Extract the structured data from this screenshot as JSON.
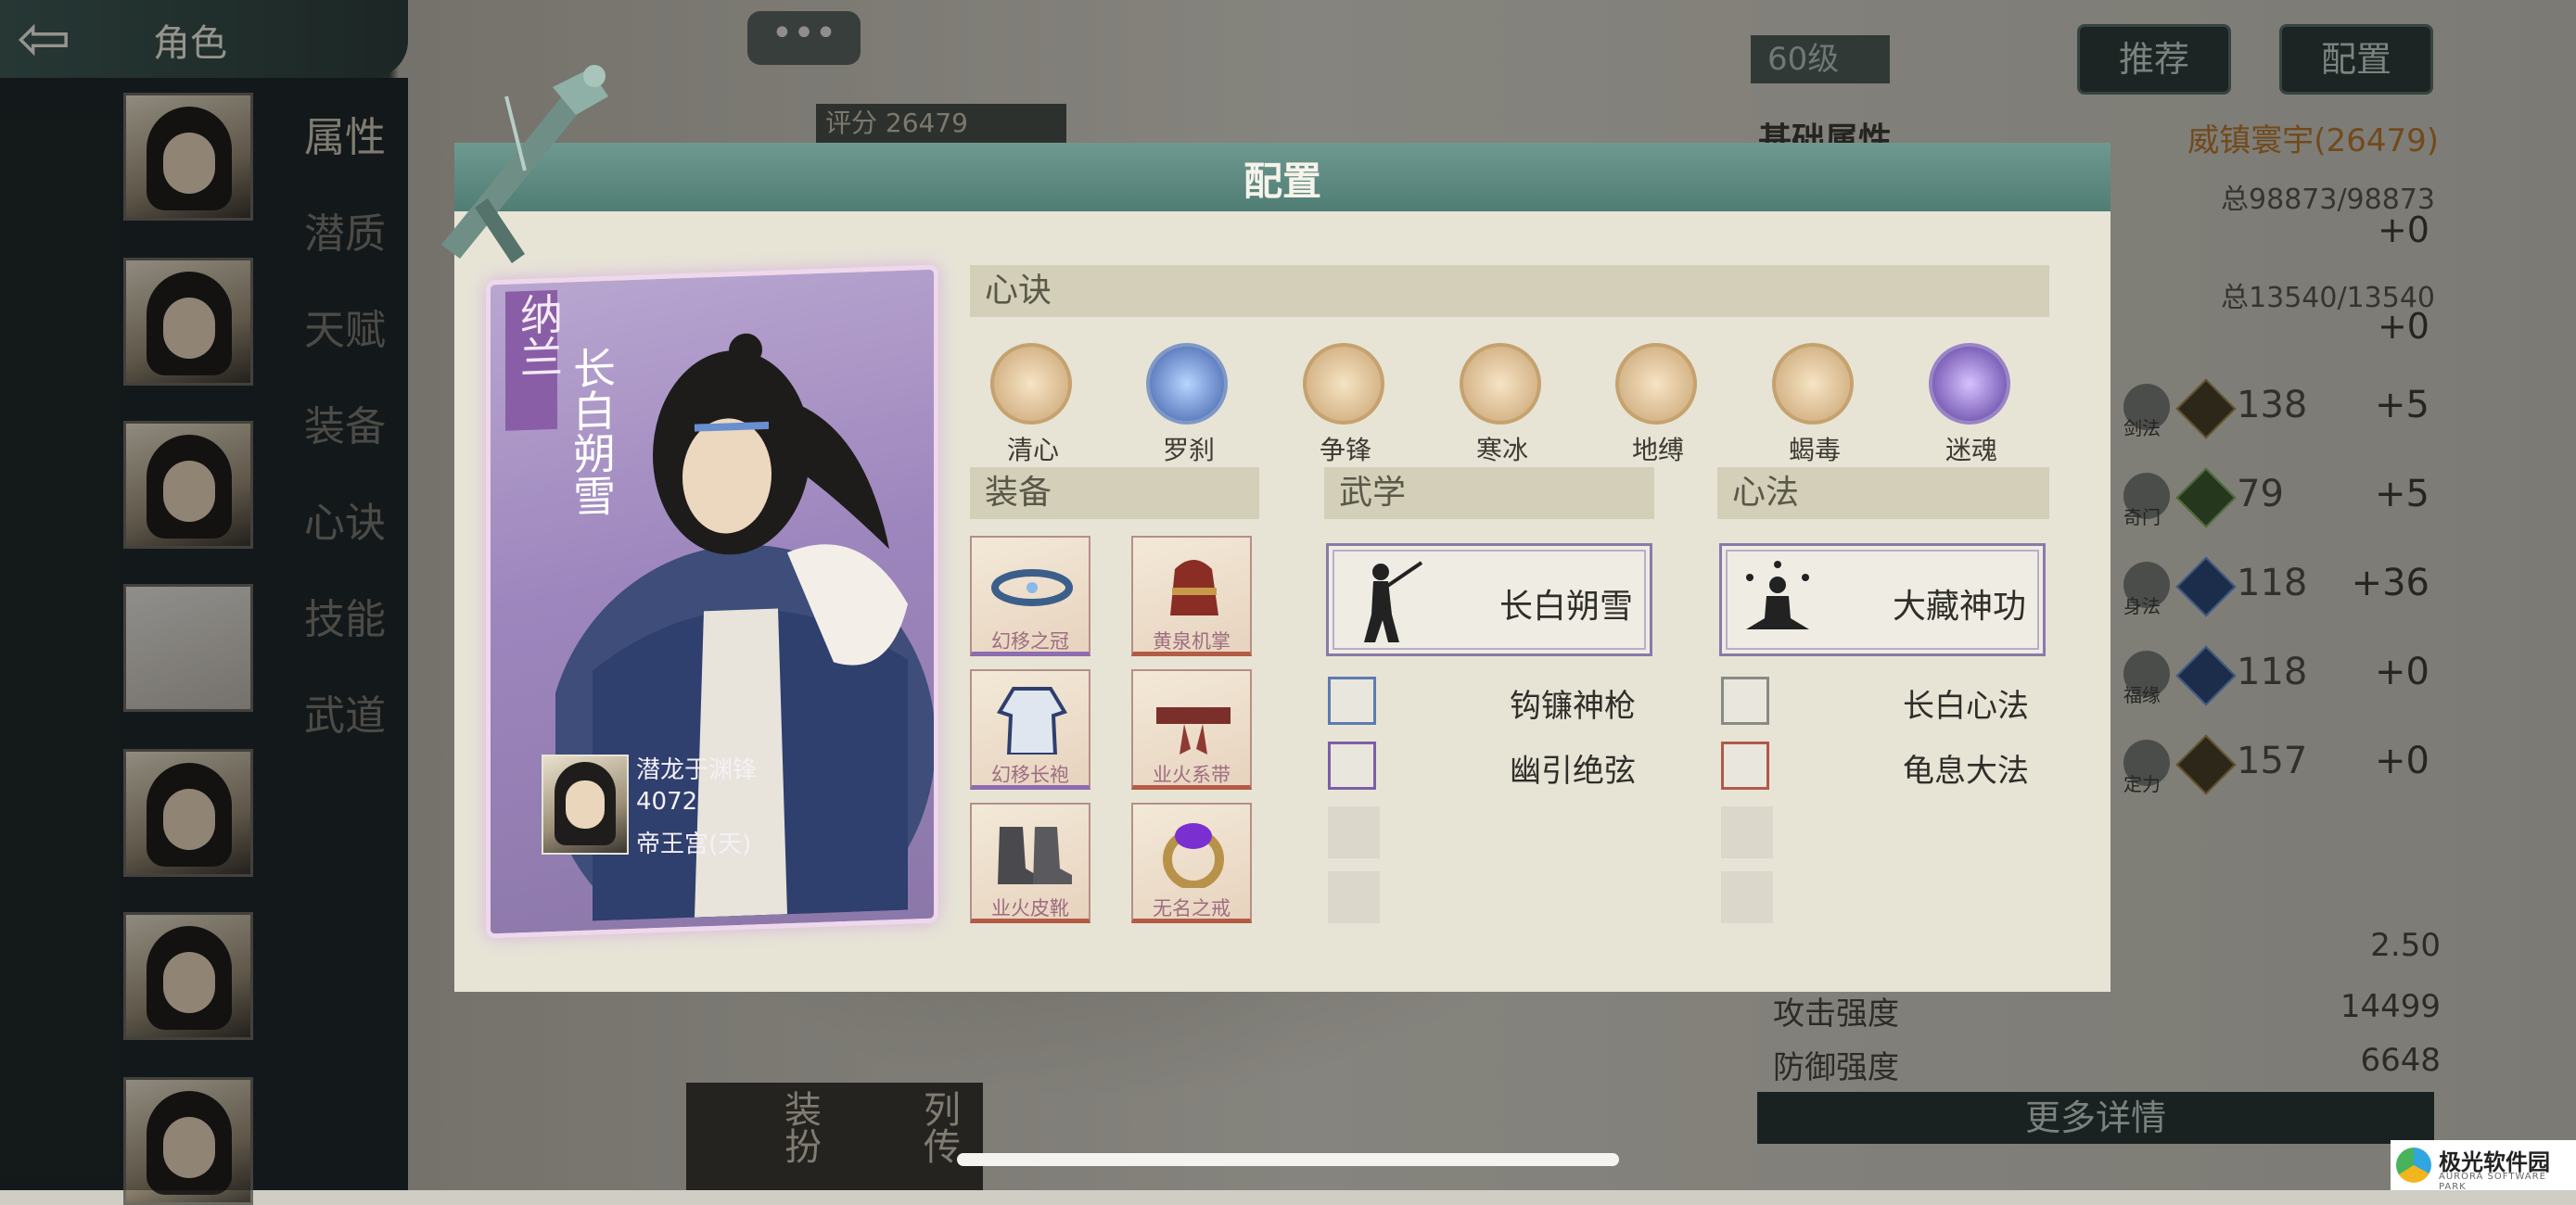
{
  "header": {
    "title": "角色",
    "back_icon": "back-arrow-icon",
    "chat_icon": "chat-bubble-icon",
    "chat_text": "•••"
  },
  "sidebar": {
    "tabs": [
      {
        "label": "属性",
        "active": true
      },
      {
        "label": "潜质",
        "active": false
      },
      {
        "label": "天赋",
        "active": false
      },
      {
        "label": "装备",
        "active": false
      },
      {
        "label": "心诀",
        "active": false
      },
      {
        "label": "技能",
        "active": false
      },
      {
        "label": "武道",
        "active": false
      }
    ]
  },
  "background": {
    "score_label": "评分",
    "score_value": "26479",
    "level": "60级",
    "buttons": {
      "recommend": "推荐",
      "config": "配置"
    },
    "base_attr_title": "基础属性",
    "base_attr_name": "威镇寰宇(26479)",
    "total_hp": "总98873/98873",
    "total_hp_plus": "+0",
    "total_mp": "总13540/13540",
    "total_mp_plus": "+0",
    "stats": [
      {
        "label": "剑法",
        "gem": "田",
        "value": "138",
        "bonus": "+5"
      },
      {
        "label": "奇门",
        "gem": "内",
        "value": "79",
        "bonus": "+5"
      },
      {
        "label": "身法",
        "gem": "",
        "value": "118",
        "bonus": "+36"
      },
      {
        "label": "福缘",
        "gem": "",
        "value": "118",
        "bonus": "+0"
      },
      {
        "label": "定力",
        "gem": "田",
        "value": "157",
        "bonus": "+0"
      }
    ],
    "bottom_stats": [
      {
        "label": "",
        "value": "2.50"
      },
      {
        "label": "攻击强度",
        "value": "14499"
      },
      {
        "label": "防御强度",
        "value": "6648"
      }
    ],
    "more_details": "更多详情",
    "bottom_tabs": [
      "装扮",
      "列传"
    ]
  },
  "modal": {
    "title": "配置",
    "character": {
      "name": "纳兰",
      "title": "长白朔雪",
      "owner_name": "潜龙于渊锋",
      "owner_score": "4072",
      "owner_server": "帝王宫(天)"
    },
    "xinjue": {
      "header": "心诀",
      "items": [
        {
          "label": "清心",
          "icon": "lotus-icon",
          "color": "#d9b98c"
        },
        {
          "label": "罗刹",
          "icon": "lightning-icon",
          "color": "#4f6fb8"
        },
        {
          "label": "争锋",
          "icon": "sword-icon",
          "color": "#d9b98c"
        },
        {
          "label": "寒冰",
          "icon": "snowflake-icon",
          "color": "#d9b98c"
        },
        {
          "label": "地缚",
          "icon": "swirl-icon",
          "color": "#d9b98c"
        },
        {
          "label": "蝎毒",
          "icon": "scorpion-icon",
          "color": "#d9b98c"
        },
        {
          "label": "迷魂",
          "icon": "spirit-icon",
          "color": "#7b57b5"
        }
      ]
    },
    "equipment": {
      "header": "装备",
      "items": [
        {
          "name": "幻移之冠",
          "rarity": "purple",
          "icon": "crown-icon"
        },
        {
          "name": "黄泉机掌",
          "rarity": "red",
          "icon": "gauntlet-icon"
        },
        {
          "name": "幻移长袍",
          "rarity": "purple",
          "icon": "robe-icon"
        },
        {
          "name": "业火系带",
          "rarity": "red",
          "icon": "belt-icon"
        },
        {
          "name": "业火皮靴",
          "rarity": "red",
          "icon": "boots-icon"
        },
        {
          "name": "无名之戒",
          "rarity": "red",
          "icon": "ring-icon"
        }
      ]
    },
    "wuxue": {
      "header": "武学",
      "main": "长白朔雪",
      "subs": [
        "钩镰神枪",
        "幽引绝弦"
      ]
    },
    "xinfa": {
      "header": "心法",
      "main": "大藏神功",
      "subs": [
        "长白心法",
        "龟息大法"
      ]
    }
  },
  "watermark": {
    "title": "极光软件园",
    "subtitle": "AURORA SOFTWARE PARK"
  }
}
